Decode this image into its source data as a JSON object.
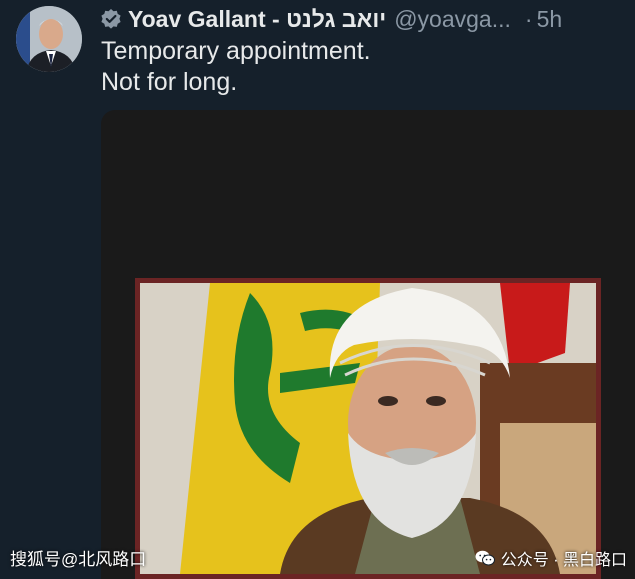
{
  "tweet": {
    "author_name": "Yoav Gallant - יואב גלנט",
    "handle": "@yoavga...",
    "separator": "·",
    "time": "5h",
    "lines": [
      "Temporary appointment.",
      "Not for long."
    ],
    "verified_icon": "verified-badge-icon",
    "media_alt": "photo of a man in a white turban in front of a yellow flag"
  },
  "watermarks": {
    "left": "搜狐号@北风路口",
    "right": "公众号 · 黑白路口",
    "right_icon": "wechat-icon"
  },
  "colors": {
    "background": "#15202b",
    "secondary_text": "#8b98a5",
    "verified": "#8b98a5"
  }
}
